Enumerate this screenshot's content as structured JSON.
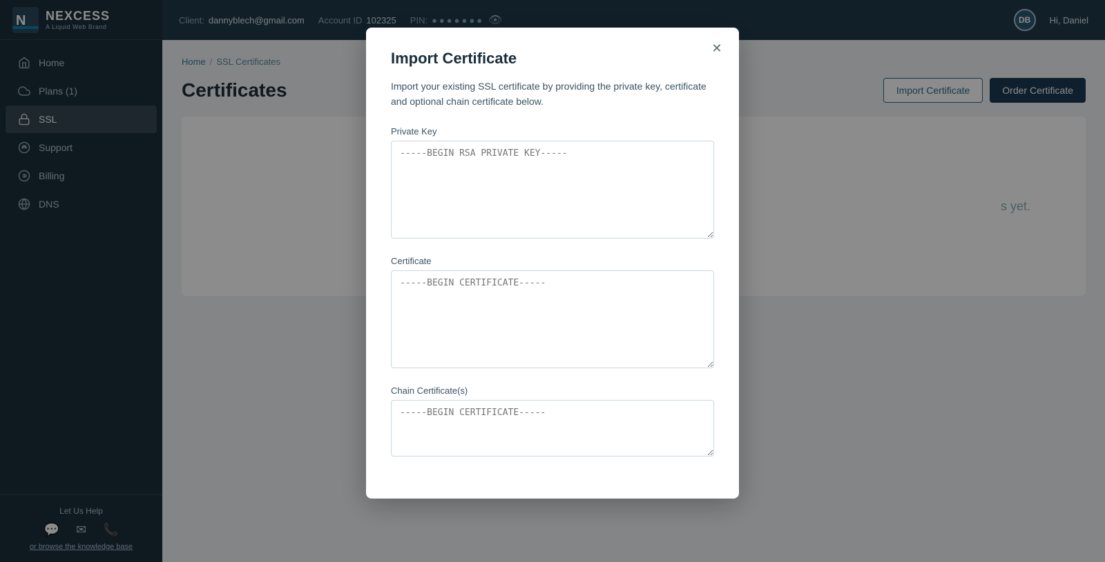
{
  "brand": {
    "name": "NEXCESS",
    "tagline": "A Liquid Web Brand"
  },
  "topbar": {
    "client_label": "Client:",
    "client_email": "dannyblech@gmail.com",
    "account_label": "Account ID",
    "account_id": "102325",
    "pin_label": "PIN:",
    "pin_dots": "●●●●●●●",
    "hi_label": "Hi, Daniel"
  },
  "sidebar": {
    "nav_items": [
      {
        "id": "home",
        "label": "Home",
        "icon": "home"
      },
      {
        "id": "plans",
        "label": "Plans (1)",
        "icon": "cloud"
      },
      {
        "id": "ssl",
        "label": "SSL",
        "icon": "lock",
        "active": true
      },
      {
        "id": "support",
        "label": "Support",
        "icon": "headset"
      },
      {
        "id": "billing",
        "label": "Billing",
        "icon": "dollar"
      },
      {
        "id": "dns",
        "label": "DNS",
        "icon": "globe"
      }
    ],
    "footer": {
      "help_text": "Let Us Help",
      "knowledge_base_link": "or browse the knowledge base"
    }
  },
  "breadcrumb": {
    "home": "Home",
    "separator": "/",
    "current": "SSL Certificates"
  },
  "page": {
    "title": "Certificates",
    "empty_message": "s yet."
  },
  "header_actions": {
    "import_label": "Import Certificate",
    "order_label": "Order Certificate"
  },
  "modal": {
    "title": "Import Certificate",
    "description": "Import your existing SSL certificate by providing the private key, certificate and optional chain certificate below.",
    "fields": [
      {
        "id": "private_key",
        "label": "Private Key",
        "placeholder": "-----BEGIN RSA PRIVATE KEY-----",
        "rows": 8
      },
      {
        "id": "certificate",
        "label": "Certificate",
        "placeholder": "-----BEGIN CERTIFICATE-----",
        "rows": 8
      },
      {
        "id": "chain_certificate",
        "label": "Chain Certificate(s)",
        "placeholder": "-----BEGIN CERTIFICATE-----",
        "rows": 4
      }
    ]
  }
}
